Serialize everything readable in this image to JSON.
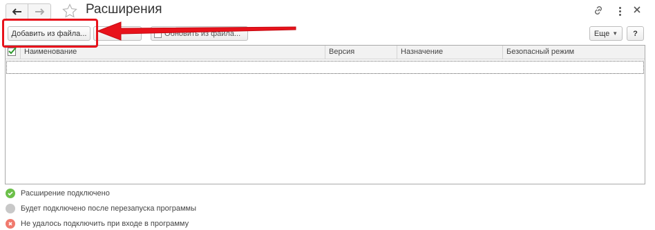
{
  "window": {
    "title": "Расширения",
    "back_icon": "arrow-left-icon",
    "forward_icon": "arrow-right-icon",
    "favorite_icon": "star-icon",
    "link_icon": "link-icon",
    "more_icon": "vertical-dots-icon",
    "close_icon": "close-icon"
  },
  "toolbar": {
    "add_from_file": "Добавить из файла...",
    "update_from_file": "Обновить из файла...",
    "more": "Еще",
    "help": "?"
  },
  "table": {
    "columns": [
      "Наименование",
      "Версия",
      "Назначение",
      "Безопасный режим"
    ],
    "rows": []
  },
  "legend": [
    {
      "label": "Расширение подключено",
      "color": "#6cc04a"
    },
    {
      "label": "Будет подключено после перезапуска программы",
      "color": "#c8c8c8"
    },
    {
      "label": "Не удалось подключить при входе в программу",
      "color": "#f07a6e"
    }
  ],
  "annotation": {
    "highlight_color": "#e8121b"
  }
}
